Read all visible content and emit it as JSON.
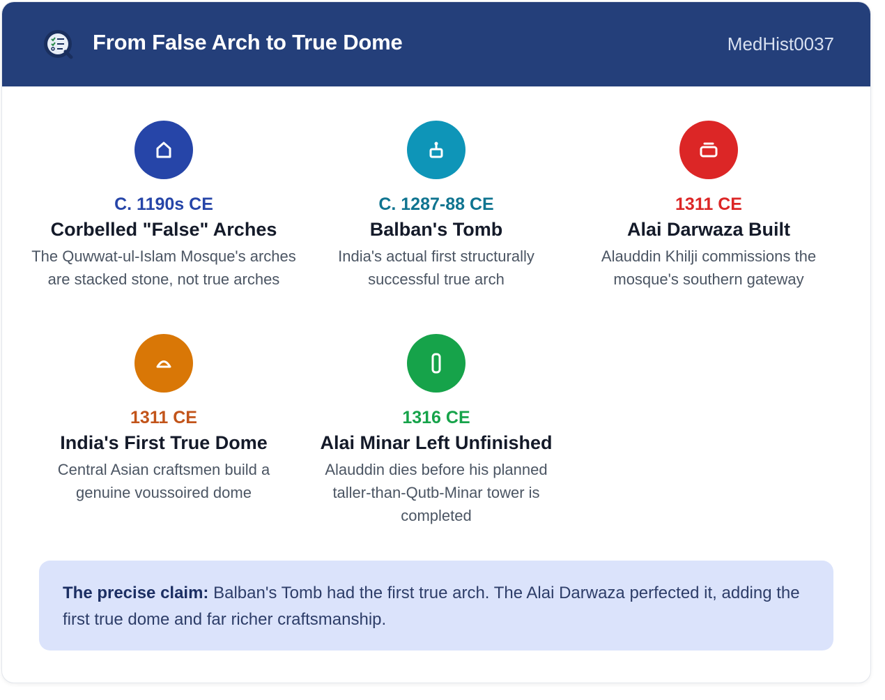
{
  "header": {
    "title": "From False Arch to True Dome",
    "code": "MedHist0037",
    "logo_icon": "quiz-checklist-icon"
  },
  "events": [
    {
      "date": "C. 1190s CE",
      "title": "Corbelled \"False\" Arches",
      "description": "The Quwwat-ul-Islam Mosque's arches are stacked stone, not true arches",
      "icon": "house-arch-icon",
      "color": "#2645a8",
      "date_color": "#2645a8"
    },
    {
      "date": "C. 1287-88 CE",
      "title": "Balban's Tomb",
      "description": "India's actual first structurally successful true arch",
      "icon": "tomb-icon",
      "color": "#0e95b8",
      "date_color": "#0f7490"
    },
    {
      "date": "1311 CE",
      "title": "Alai Darwaza Built",
      "description": "Alauddin Khilji commissions the mosque's southern gateway",
      "icon": "gateway-icon",
      "color": "#dc2626",
      "date_color": "#dc2626"
    },
    {
      "date": "1311 CE",
      "title": "India's First True Dome",
      "description": "Central Asian craftsmen build a genuine voussoired dome",
      "icon": "dome-icon",
      "color": "#d97706",
      "date_color": "#c2541a"
    },
    {
      "date": "1316 CE",
      "title": "Alai Minar Left Unfinished",
      "description": "Alauddin dies before his planned taller-than-Qutb-Minar tower is completed",
      "icon": "minaret-icon",
      "color": "#16a34a",
      "date_color": "#16a34a"
    }
  ],
  "note": {
    "lead": "The precise claim:",
    "text": " Balban's Tomb had the first true arch. The Alai Darwaza perfected it, adding the first true dome and far richer craftsmanship."
  }
}
